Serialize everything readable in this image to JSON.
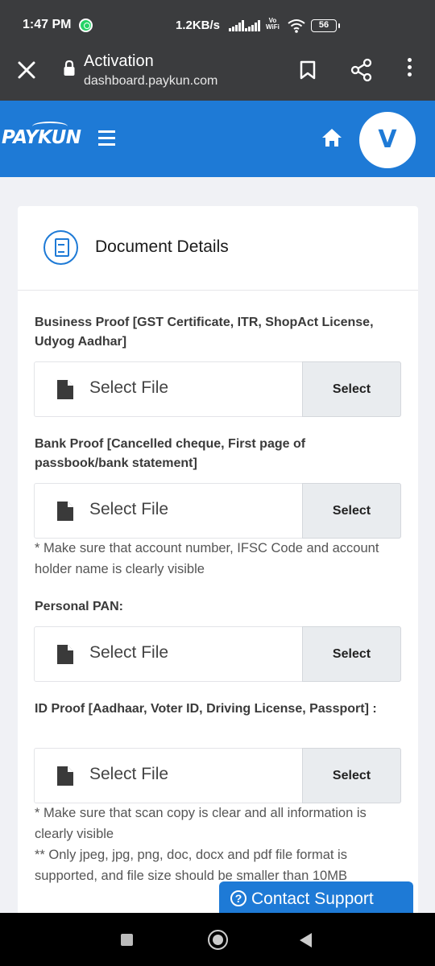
{
  "status_bar": {
    "time": "1:47 PM",
    "speed": "1.2KB/s",
    "volte_line1": "Vo",
    "volte_line2": "WiFi",
    "battery": "56"
  },
  "browser": {
    "title": "Activation",
    "url": "dashboard.paykun.com"
  },
  "header": {
    "logo": "PAYKUN",
    "avatar_initial": "V"
  },
  "card": {
    "title": "Document Details",
    "fields": [
      {
        "label": "Business Proof [GST Certificate, ITR, ShopAct License, Udyog Aadhar]",
        "placeholder": "Select File",
        "button": "Select"
      },
      {
        "label": "Bank Proof [Cancelled cheque, First page of passbook/bank statement]",
        "placeholder": "Select File",
        "button": "Select",
        "note": "* Make sure that account number, IFSC Code and account holder name is clearly visible"
      },
      {
        "label": "Personal PAN:",
        "placeholder": "Select File",
        "button": "Select"
      },
      {
        "label": "ID Proof [Aadhaar, Voter ID, Driving License, Passport] :",
        "placeholder": "Select File",
        "button": "Select",
        "note": "* Make sure that scan copy is clear and all information is clearly visible",
        "note2": "** Only jpeg, jpg, png, doc, docx and pdf file format is supported, and file size should be smaller than 10MB"
      }
    ]
  },
  "contact_support": {
    "label": "Contact Support"
  },
  "colors": {
    "brand": "#1e7ad6",
    "topbar": "#3b3c3e"
  }
}
